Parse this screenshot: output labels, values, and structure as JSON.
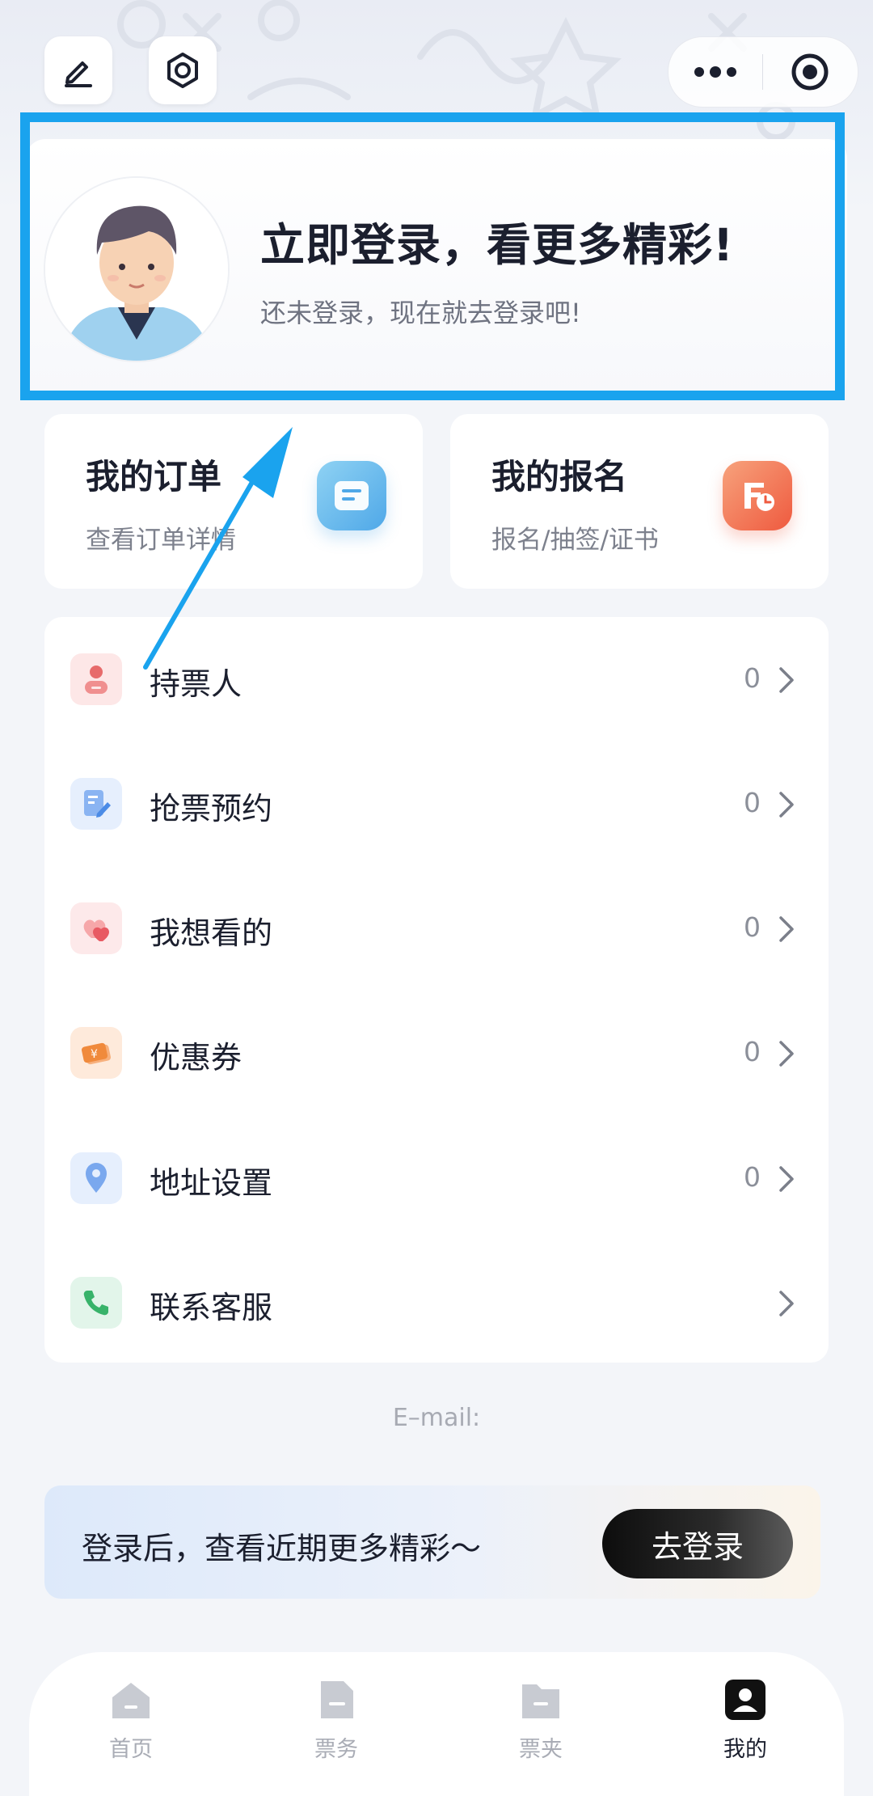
{
  "login_card": {
    "title": "立即登录，看更多精彩!",
    "subtitle": "还未登录，现在就去登录吧!"
  },
  "quick_cards": [
    {
      "title": "我的订单",
      "subtitle": "查看订单详情",
      "icon": "order-icon",
      "color": "#5ab3ee"
    },
    {
      "title": "我的报名",
      "subtitle": "报名/抽签/证书",
      "icon": "signup-icon",
      "color": "#f26d4f"
    }
  ],
  "menu_items": [
    {
      "label": "持票人",
      "count": "0",
      "icon": "ticket-holder-icon"
    },
    {
      "label": "抢票预约",
      "count": "0",
      "icon": "reservation-icon"
    },
    {
      "label": "我想看的",
      "count": "0",
      "icon": "heart-icon"
    },
    {
      "label": "优惠券",
      "count": "0",
      "icon": "coupon-icon"
    },
    {
      "label": "地址设置",
      "count": "0",
      "icon": "location-icon"
    },
    {
      "label": "联系客服",
      "count": "",
      "icon": "phone-icon"
    }
  ],
  "email_label": "E–mail:",
  "banner": {
    "text": "登录后，查看近期更多精彩～",
    "button_label": "去登录"
  },
  "tabbar": [
    {
      "label": "首页",
      "icon": "home-icon",
      "active": false
    },
    {
      "label": "票务",
      "icon": "ticket-icon",
      "active": false
    },
    {
      "label": "票夹",
      "icon": "ticket-folder-icon",
      "active": false
    },
    {
      "label": "我的",
      "icon": "profile-icon",
      "active": true
    }
  ],
  "annotation": {
    "highlight_color": "#1aa3ee"
  }
}
